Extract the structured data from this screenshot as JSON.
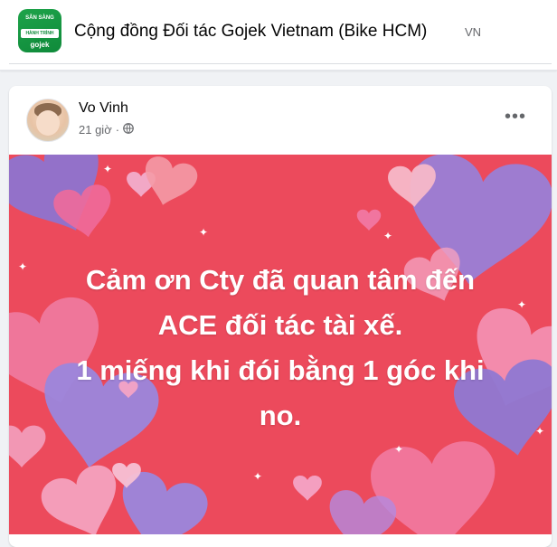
{
  "group": {
    "logo_title": "SẴN SÀNG",
    "logo_band": "HÀNH TRÌNH MỚI",
    "logo_brand": "gojek",
    "title": "Cộng đồng Đối tác Gojek Vietnam (Bike HCM)",
    "lang": "VN"
  },
  "post": {
    "author": "Vo Vinh",
    "time": "21 giờ",
    "separator": "·",
    "more_label": "•••",
    "text_lines": [
      "Cảm ơn Cty đã quan tâm đến",
      "ACE đối tác tài xế.",
      "1 miếng khi đói bằng 1 góc khi",
      "no."
    ]
  },
  "icons": {
    "audience": "globe-icon",
    "more": "more-options-icon"
  },
  "colors": {
    "image_background": "#ec4a5c",
    "heart_purple": "#9b7fd8",
    "heart_pink": "#f08fb0",
    "heart_light": "#f6b9c9"
  }
}
